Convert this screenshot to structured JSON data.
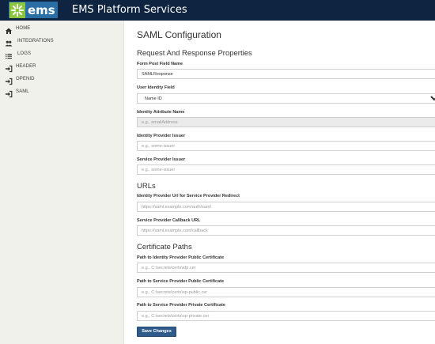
{
  "header": {
    "logo_text": "ems",
    "app_title": "EMS Platform Services"
  },
  "sidebar": {
    "items": [
      {
        "label": "HOME",
        "icon": "home-icon"
      },
      {
        "label": "INTEGRATIONS",
        "icon": "users-icon"
      },
      {
        "label": "LOGS",
        "icon": "list-icon"
      },
      {
        "label": "HEADER",
        "icon": "sign-in-icon"
      },
      {
        "label": "OPENID",
        "icon": "sign-in-icon"
      },
      {
        "label": "SAML",
        "icon": "sign-in-icon"
      }
    ]
  },
  "main": {
    "page_title": "SAML Configuration",
    "sections": {
      "request": "Request And Response Properties",
      "urls": "URLs",
      "certs": "Certificate Paths"
    },
    "fields": {
      "form_post": {
        "label": "Form Post Field Name",
        "value": "SAMLResponse",
        "placeholder": ""
      },
      "user_identity": {
        "label": "User Identity Field",
        "value": "Name ID",
        "placeholder": ""
      },
      "identity_attr": {
        "label": "Identity Attribute Name",
        "value": "",
        "placeholder": "e.g., emailAddress"
      },
      "idp_issuer": {
        "label": "Identity Provider Issuer",
        "value": "",
        "placeholder": "e.g., some-issuer"
      },
      "sp_issuer": {
        "label": "Service Provider Issuer",
        "value": "",
        "placeholder": "e.g., some-issuer"
      },
      "idp_redirect": {
        "label": "Identity Provider Url for Service Provider Redirect",
        "value": "",
        "placeholder": "https://saml.example.com/auth/saml"
      },
      "sp_callback": {
        "label": "Service Provider Callback URL",
        "value": "",
        "placeholder": "https://saml.example.com/callback"
      },
      "idp_cert": {
        "label": "Path to Identity Provider Public Certificate",
        "value": "",
        "placeholder": "e.g., C:\\secrets\\certs\\idp.cer"
      },
      "sp_public_cert": {
        "label": "Path to Service Provider Public Certificate",
        "value": "",
        "placeholder": "e.g., C:\\secrets\\certs\\sp-public.cer"
      },
      "sp_private_cert": {
        "label": "Path to Service Provider Private Certificate",
        "value": "",
        "placeholder": "e.g., C:\\secrets\\certs\\sp-private.cer"
      }
    },
    "save_label": "Save Changes"
  },
  "colors": {
    "topbar": "#0e2440",
    "logo_bg": "#2a6ea6",
    "logo_mark": "#8cc63f",
    "sidebar_bg": "#f1f1ec",
    "button": "#2e5b8a"
  }
}
